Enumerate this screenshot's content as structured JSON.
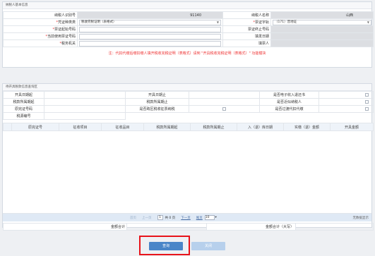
{
  "basic": {
    "title": "纳税人基本信息",
    "taxpayer_id_label": "纳税人识别号",
    "taxpayer_id_value": "91140",
    "taxpayer_name_label": "纳税人名称",
    "taxpayer_name_value": "山西",
    "voucher_type_label": "凭证种类类",
    "voucher_type_value": "税收完税证明（表格式）",
    "ticket_type_label": "票证字轨",
    "ticket_type_value": "（171）晋地证",
    "start_no_label": "票证起始号码",
    "end_no_label": "票证终止号码",
    "current_no_label": "当前使用票证号码",
    "fill_date_label": "填发日期",
    "tax_office_label": "税务机关",
    "filler_label": "填票人"
  },
  "notice": "注：代扣代缴后缴扣缴人填开税收完税证明（表格式）请到 \"开具税收完税证明（表格式）\" 功能模块",
  "query": {
    "title": "待开具税款信息查询区",
    "open_start_label": "开具日期起",
    "open_end_label": "开具日期止",
    "is_e_ticket_label": "是否电子收入退还书",
    "period_start_label": "税款所属期起",
    "period_end_label": "税款所属期止",
    "is_agent_label": "是否近似纳税人",
    "voucher_no_label": "原完证号码",
    "cross_region_label": "是否跨区税收征票纳税",
    "is_withhold_label": "是否过渡代扣代缴",
    "tax_form_label": "税源编号"
  },
  "grid": {
    "columns": [
      "原完证号",
      "征收项目",
      "征收品目",
      "税款所属期起",
      "税款所属期止",
      "入（退）库日期",
      "实缴（退）金额",
      "开具金额"
    ]
  },
  "pager": {
    "first": "首页",
    "prev": "上一页",
    "page": "1",
    "total_pages": "共 0 页",
    "next": "下一页",
    "last": "尾页",
    "page_size": "10",
    "no_data": "无数据显示"
  },
  "totals": {
    "sum_label": "金额合计",
    "sum_upper_label": "金额合计（大写）"
  },
  "actions": {
    "query_label": "查询",
    "close_label": "关闭"
  },
  "colors": {
    "primary": "#4a86c8",
    "disabled": "#b7d0ec",
    "highlight": "#e8131a"
  }
}
